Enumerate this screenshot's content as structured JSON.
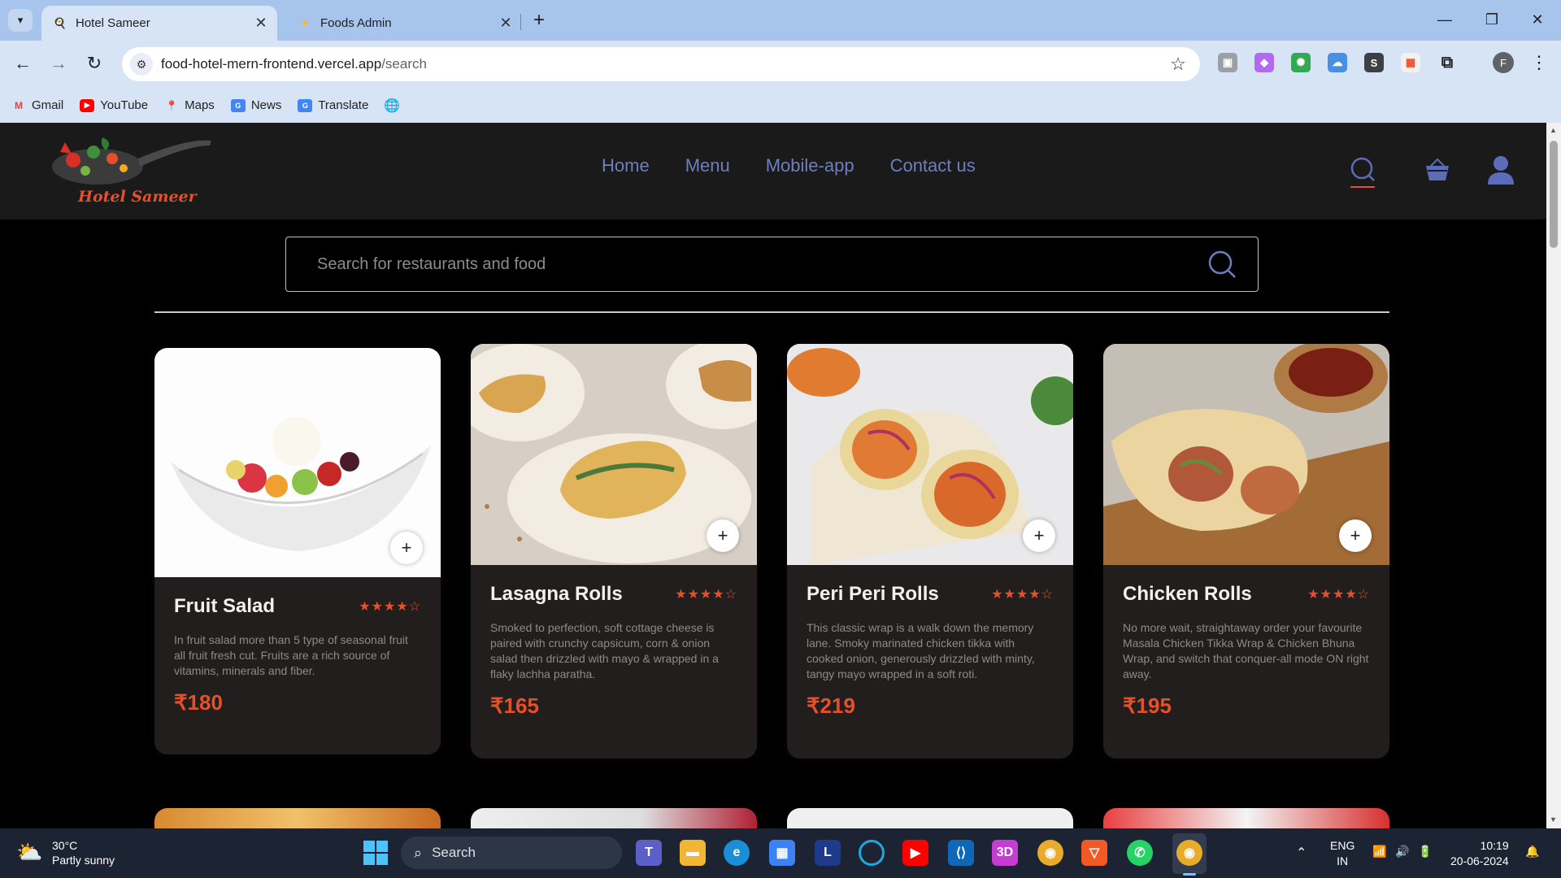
{
  "browser": {
    "tabs": [
      {
        "title": "Hotel Sameer",
        "active": true
      },
      {
        "title": "Foods Admin",
        "active": false
      }
    ],
    "url_host": "food-hotel-mern-frontend.vercel.app",
    "url_path": "/search",
    "bookmarks": [
      {
        "label": "Gmail",
        "icon": "gmail-icon"
      },
      {
        "label": "YouTube",
        "icon": "youtube-icon"
      },
      {
        "label": "Maps",
        "icon": "maps-icon"
      },
      {
        "label": "News",
        "icon": "news-icon"
      },
      {
        "label": "Translate",
        "icon": "translate-icon"
      }
    ]
  },
  "site": {
    "brand": "Hotel Sameer",
    "menu": [
      "Home",
      "Menu",
      "Mobile-app",
      "Contact us"
    ],
    "accent": "#e4502a",
    "nav_color": "#6d7fbb"
  },
  "search": {
    "placeholder": "Search for restaurants and food"
  },
  "foods": [
    {
      "name": "Fruit Salad",
      "rating": 4,
      "description": "In fruit salad more than 5 type of seasonal fruit all fruit fresh cut. Fruits are a rich source of vitamins, minerals and fiber.",
      "price": "₹180"
    },
    {
      "name": "Lasagna Rolls",
      "rating": 4,
      "description": "Smoked to perfection, soft cottage cheese is paired with crunchy capsicum, corn & onion salad then drizzled with mayo & wrapped in a flaky lachha paratha.",
      "price": "₹165"
    },
    {
      "name": "Peri Peri Rolls",
      "rating": 4,
      "description": "This classic wrap is a walk down the memory lane. Smoky marinated chicken tikka with cooked onion, generously drizzled with minty, tangy mayo wrapped in a soft roti.",
      "price": "₹219"
    },
    {
      "name": "Chicken Rolls",
      "rating": 4,
      "description": "No more wait, straightaway order your favourite Masala Chicken Tikka Wrap & Chicken Bhuna Wrap, and switch that conquer-all mode ON right away.",
      "price": "₹195"
    }
  ],
  "taskbar": {
    "weather_temp": "30°C",
    "weather_desc": "Partly sunny",
    "search_label": "Search",
    "lang_top": "ENG",
    "lang_bottom": "IN",
    "time": "10:19",
    "date": "20-06-2024"
  }
}
